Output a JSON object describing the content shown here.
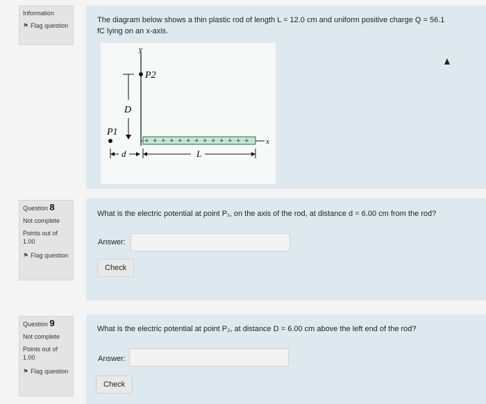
{
  "info_box": {
    "heading": "Information",
    "flag_label": "Flag question",
    "flag_icon": "flag-icon"
  },
  "info_panel": {
    "text_line1": "The diagram below shows a thin plastic rod of length L = 12.0 cm and uniform positive charge Q = 56.1",
    "text_line2": "fC lying on an x-axis.",
    "diagram": {
      "y_label": "y",
      "p2_label": "P2",
      "d_upper_label": "D",
      "p1_label": "P1",
      "x_label": "x",
      "d_lower_label": "d",
      "l_label": "L",
      "plus_sign": "+"
    }
  },
  "questions": [
    {
      "number_prefix": "Question",
      "number": "8",
      "status": "Not complete",
      "points_line1": "Points out of",
      "points_value": "1.00",
      "flag_label": "Flag question",
      "text": "What is the electric potential at point P₁, on the axis of the rod, at distance d = 6.00 cm from the rod?",
      "answer_label": "Answer:",
      "answer_value": "",
      "check_label": "Check"
    },
    {
      "number_prefix": "Question",
      "number": "9",
      "status": "Not complete",
      "points_line1": "Points out of",
      "points_value": "1.00",
      "flag_label": "Flag question",
      "text": "What is the electric potential at point P₂, at distance D = 6.00 cm above the left end of the rod?",
      "answer_label": "Answer:",
      "answer_value": "",
      "check_label": "Check"
    }
  ]
}
